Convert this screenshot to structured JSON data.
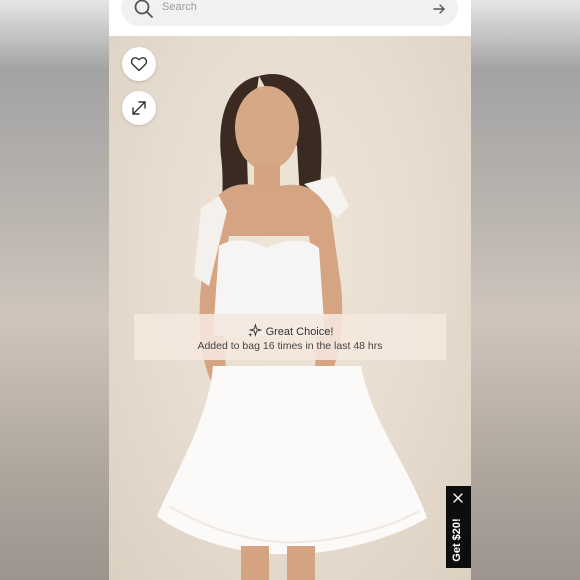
{
  "search": {
    "placeholder": "Search"
  },
  "product": {
    "photo_description_icon": "product-photo"
  },
  "toast": {
    "title": "Great Choice!",
    "subtitle": "Added to bag 16 times in the last 48 hrs"
  },
  "promo": {
    "label": "Get $20!"
  },
  "icons": {
    "search": "search-icon",
    "arrow": "arrow-right-icon",
    "wishlist": "heart-icon",
    "expand": "expand-icon",
    "sparkle": "sparkle-icon",
    "close": "close-icon"
  },
  "colors": {
    "background": "#e8e0d5",
    "promo": "#0d0d0d",
    "toast": "#f5e8de"
  }
}
